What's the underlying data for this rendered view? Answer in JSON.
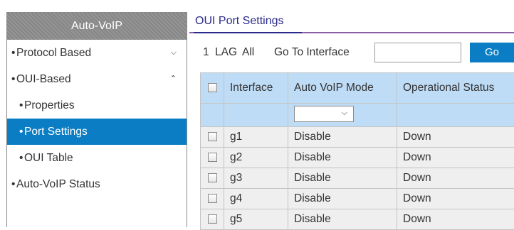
{
  "sidebar": {
    "header": "Auto-VoIP",
    "items": [
      {
        "label": "Protocol Based",
        "chevron": "⌄"
      },
      {
        "label": "OUI-Based",
        "chevron": "⌃"
      },
      {
        "label": "Properties"
      },
      {
        "label": "Port Settings"
      },
      {
        "label": "OUI Table"
      },
      {
        "label": "Auto-VoIP Status"
      }
    ]
  },
  "main": {
    "title": "OUI Port Settings",
    "toolbar": {
      "link_1": "1",
      "link_lag": "LAG",
      "link_all": "All",
      "goto_label": "Go To Interface",
      "goto_value": "",
      "go_button": "Go"
    },
    "table": {
      "columns": [
        "Interface",
        "Auto VoIP Mode",
        "Operational Status"
      ],
      "rows": [
        {
          "interface": "g1",
          "mode": "Disable",
          "status": "Down"
        },
        {
          "interface": "g2",
          "mode": "Disable",
          "status": "Down"
        },
        {
          "interface": "g3",
          "mode": "Disable",
          "status": "Down"
        },
        {
          "interface": "g4",
          "mode": "Disable",
          "status": "Down"
        },
        {
          "interface": "g5",
          "mode": "Disable",
          "status": "Down"
        }
      ]
    }
  },
  "colors": {
    "accent": "#0a7dc4",
    "header_gray": "#8e8e8e",
    "table_header": "#bfdcf6",
    "row_bg": "#efefef",
    "title_purple": "#8a5fa3"
  },
  "icons": {
    "expand": "chevron-down-icon",
    "collapse": "chevron-up-icon",
    "dropdown": "chevron-down-icon"
  }
}
